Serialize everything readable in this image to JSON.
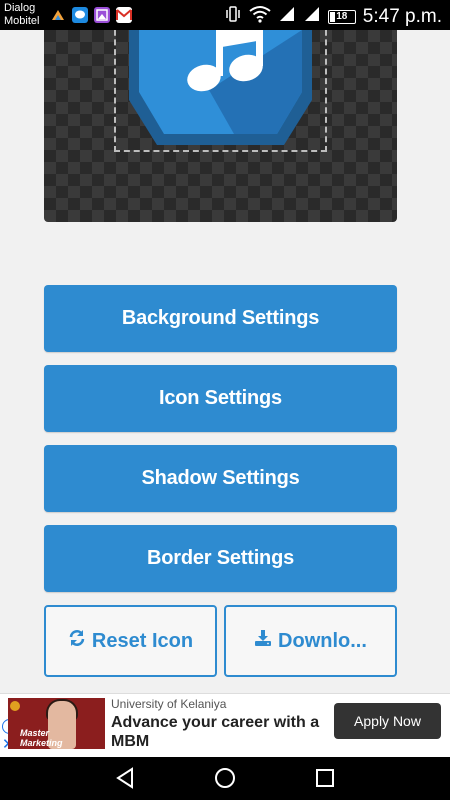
{
  "status_bar": {
    "carrier_line1": "Dialog",
    "carrier_line2": "Mobitel",
    "battery_level": "18",
    "time": "5:47 p.m.",
    "icons": [
      "dragon-icon",
      "chat-icon",
      "image-icon",
      "gmail-icon",
      "vibrate-icon",
      "wifi-icon",
      "signal-icon",
      "signal-icon",
      "battery-icon"
    ]
  },
  "buttons": {
    "background_settings": "Background Settings",
    "icon_settings": "Icon Settings",
    "shadow_settings": "Shadow Settings",
    "border_settings": "Border Settings",
    "reset_icon": "Reset Icon",
    "download": "Downlo..."
  },
  "ad": {
    "image_text_line1": "Master",
    "image_text_line2": "Marketing",
    "sponsor": "University of Kelaniya",
    "headline": "Advance your career with a MBM",
    "cta": "Apply Now"
  },
  "colors": {
    "primary": "#2e8bd0",
    "icon_blue": "#2f8fd8",
    "icon_dark": "#1f5f95"
  }
}
